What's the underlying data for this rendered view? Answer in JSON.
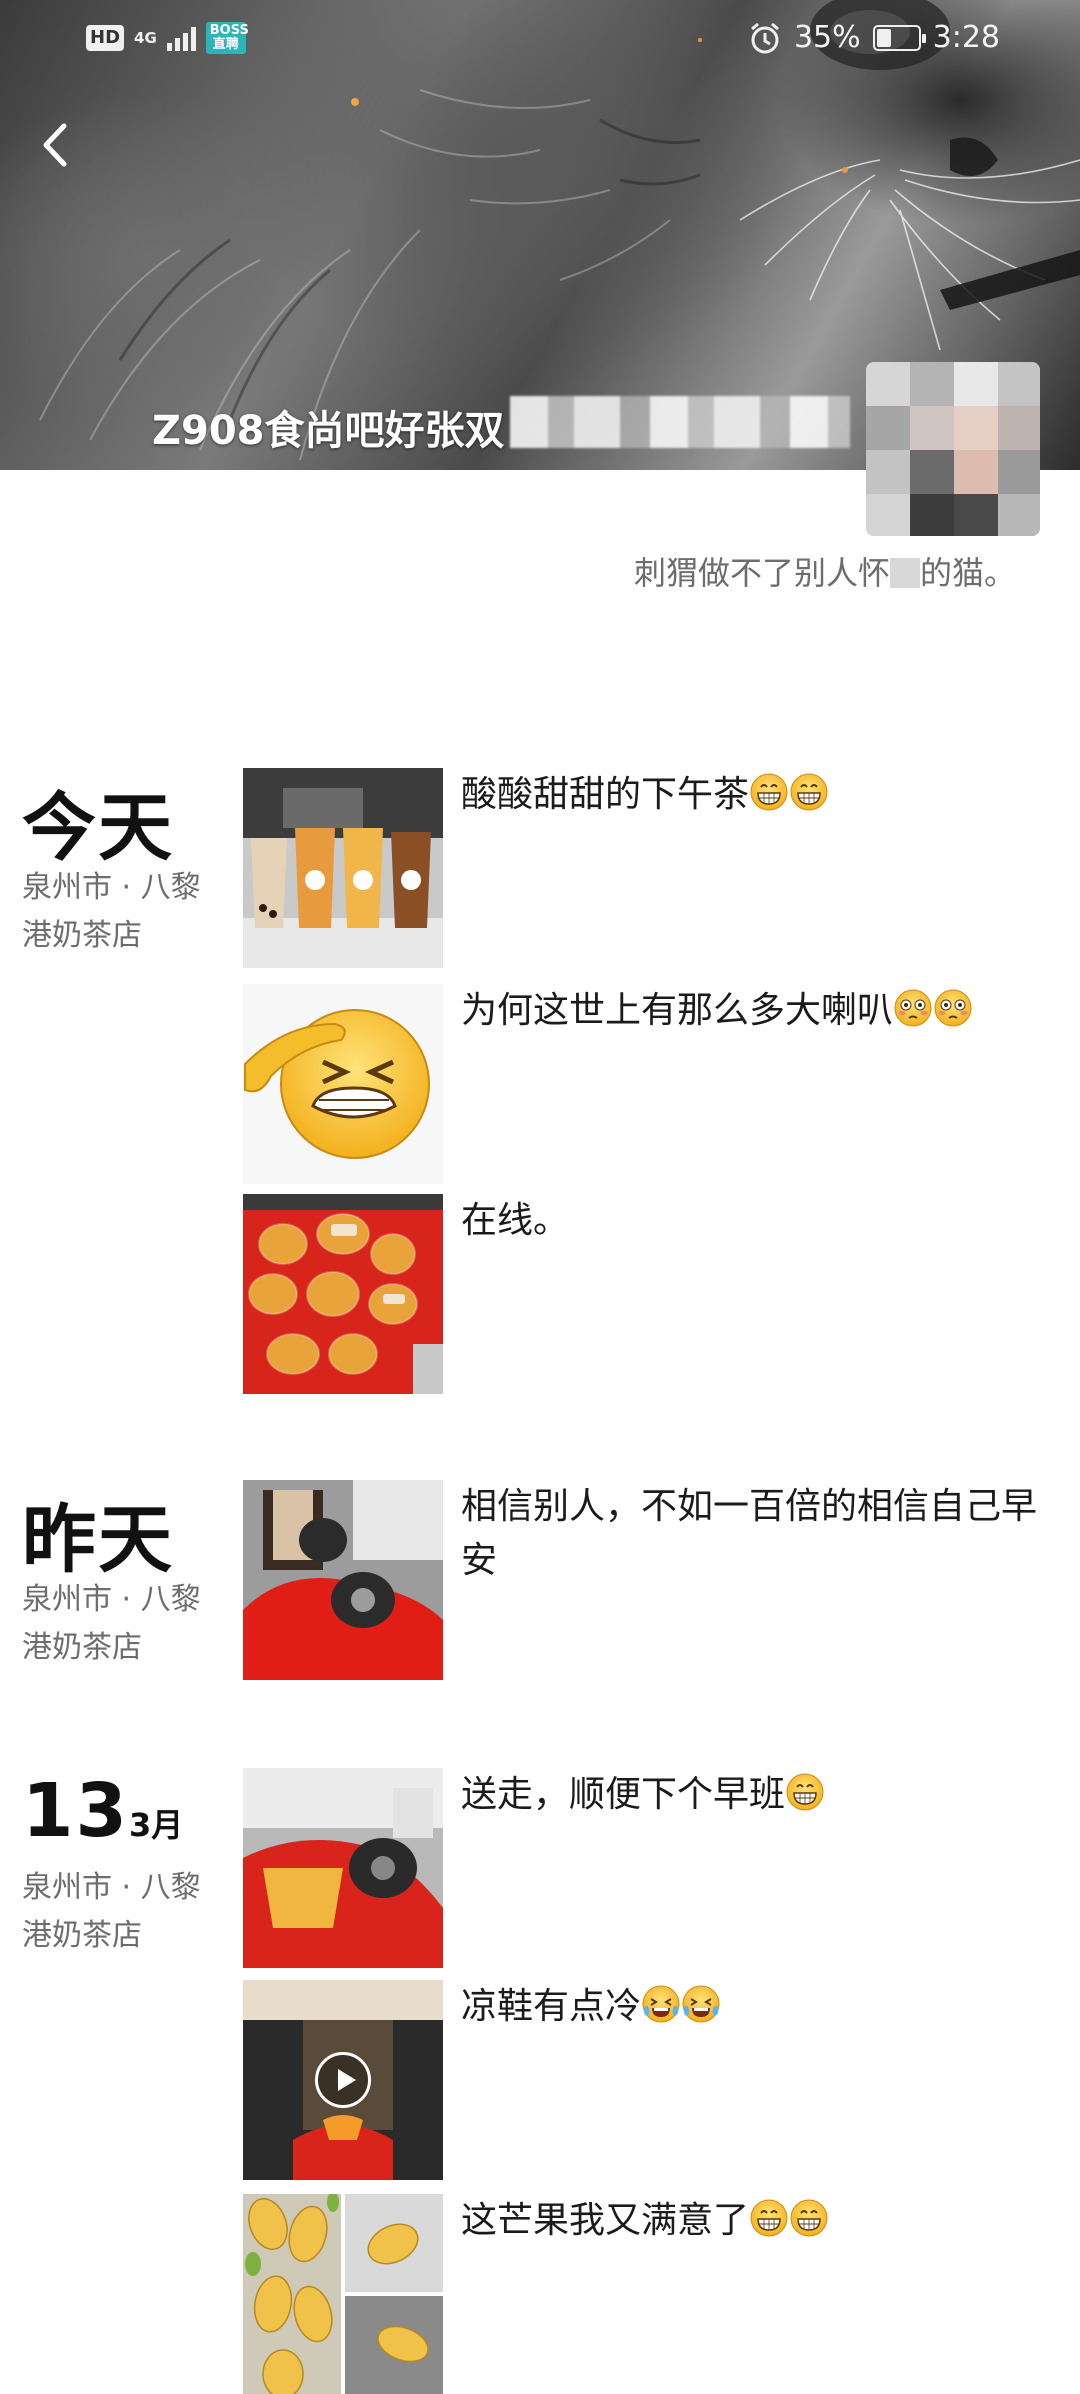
{
  "status_bar": {
    "hd_label": "HD",
    "network_label": "4G",
    "app_badge": "BOSS直聘",
    "battery_percent": "35%",
    "battery_level": 0.35,
    "time": "3:28"
  },
  "profile": {
    "name": "Z908食尚吧好张双",
    "signature_before": "刺猬做不了别人怀",
    "signature_after": "的猫。"
  },
  "days": [
    {
      "title": "今天",
      "location": "泉州市 · 八黎港奶茶店",
      "posts": [
        {
          "text": "酸酸甜甜的下午茶",
          "emoji": "grinning-face-icon",
          "emoji_count": 2,
          "thumb": "milk-tea-cups"
        },
        {
          "text": "为何这世上有那么多大喇叭",
          "emoji": "flushed-face-icon",
          "emoji_count": 2,
          "thumb": "facepalm-emoji"
        },
        {
          "text": "在线。",
          "emoji": "",
          "emoji_count": 0,
          "thumb": "bread-in-red-bag"
        }
      ]
    },
    {
      "title": "昨天",
      "location": "泉州市 · 八黎港奶茶店",
      "posts": [
        {
          "text": "相信别人，不如一百倍的相信自己早安",
          "emoji": "",
          "emoji_count": 0,
          "thumb": "tea-cups-red-bag"
        }
      ]
    },
    {
      "title_day": "13",
      "title_month": "3月",
      "location": "泉州市 · 八黎港奶茶店",
      "posts": [
        {
          "text": "送走，顺便下个早班",
          "emoji": "grinning-face-icon",
          "emoji_count": 1,
          "thumb": "bags-and-cups"
        },
        {
          "text": "凉鞋有点冷",
          "emoji": "crying-laughing-face-icon",
          "emoji_count": 2,
          "thumb": "video-shoes"
        },
        {
          "text": "这芒果我又满意了",
          "emoji": "grinning-face-icon",
          "emoji_count": 2,
          "thumb": "mangoes"
        }
      ]
    }
  ],
  "colors": {
    "text_primary": "#1b1b1b",
    "text_secondary": "#6d6d6d",
    "boss_badge": "#2bb5b8"
  }
}
